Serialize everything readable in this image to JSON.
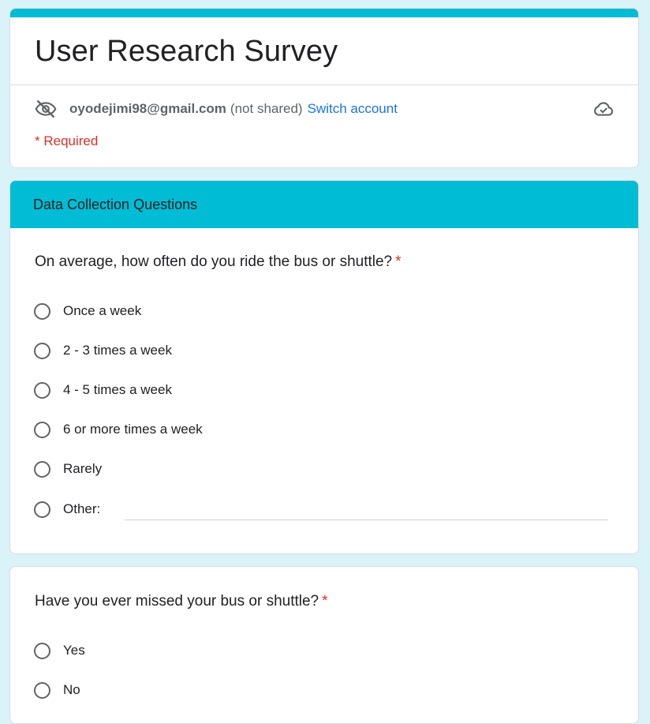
{
  "form": {
    "title": "User Research Survey",
    "account": {
      "email": "oyodejimi98@gmail.com",
      "not_shared": "(not shared)",
      "switch_label": "Switch account"
    },
    "required_note": "* Required"
  },
  "section": {
    "title": "Data Collection Questions"
  },
  "questions": [
    {
      "text": "On average, how often do you ride the bus or shuttle?",
      "required_mark": "*",
      "options": [
        "Once a week",
        "2 - 3 times a week",
        "4 - 5 times a week",
        "6 or more times a week",
        "Rarely",
        "Other:"
      ]
    },
    {
      "text": "Have you ever missed your bus or shuttle?",
      "required_mark": "*",
      "options": [
        "Yes",
        "No"
      ]
    }
  ],
  "icons": {
    "visibility_off": "eye-off-icon",
    "cloud_saved": "cloud-check-icon"
  },
  "colors": {
    "accent": "#00bcd4",
    "background": "#d9f3f8",
    "required": "#d93025",
    "link": "#1a73e8"
  }
}
